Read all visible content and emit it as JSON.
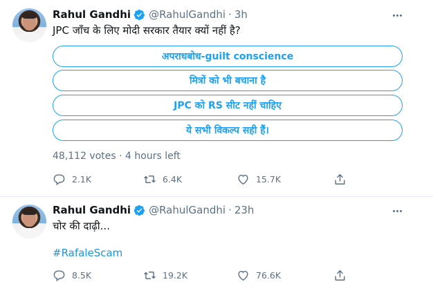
{
  "tweets": [
    {
      "author": {
        "name": "Rahul Gandhi",
        "handle": "@RahulGandhi"
      },
      "separator": "·",
      "time": "3h",
      "text": "JPC जाँच के लिए मोदी सरकार तैयार क्यों नहीं है?",
      "poll": {
        "options": [
          "अपराधबोध-guilt conscience",
          "मित्रों को भी बचाना है",
          "JPC को RS सीट नहीं चाहिए",
          "ये सभी विकल्प सही हैं।"
        ],
        "status": "48,112 votes · 4 hours left"
      },
      "actions": {
        "replies": "2.1K",
        "retweets": "6.4K",
        "likes": "15.7K"
      }
    },
    {
      "author": {
        "name": "Rahul Gandhi",
        "handle": "@RahulGandhi"
      },
      "separator": "·",
      "time": "23h",
      "text": "चोर की दाढ़ी...",
      "hashtag": "#RafaleScam",
      "actions": {
        "replies": "8.5K",
        "retweets": "19.2K",
        "likes": "76.6K"
      }
    }
  ],
  "icons": {
    "verified": "verified-badge-icon",
    "more": "more-options-icon",
    "reply": "reply-icon",
    "retweet": "retweet-icon",
    "like": "heart-icon",
    "share": "share-icon"
  },
  "colors": {
    "accent": "#1da1f2",
    "hashtag": "#1b95e0",
    "secondary_text": "#5b7083",
    "divider": "#e6ecf0"
  }
}
